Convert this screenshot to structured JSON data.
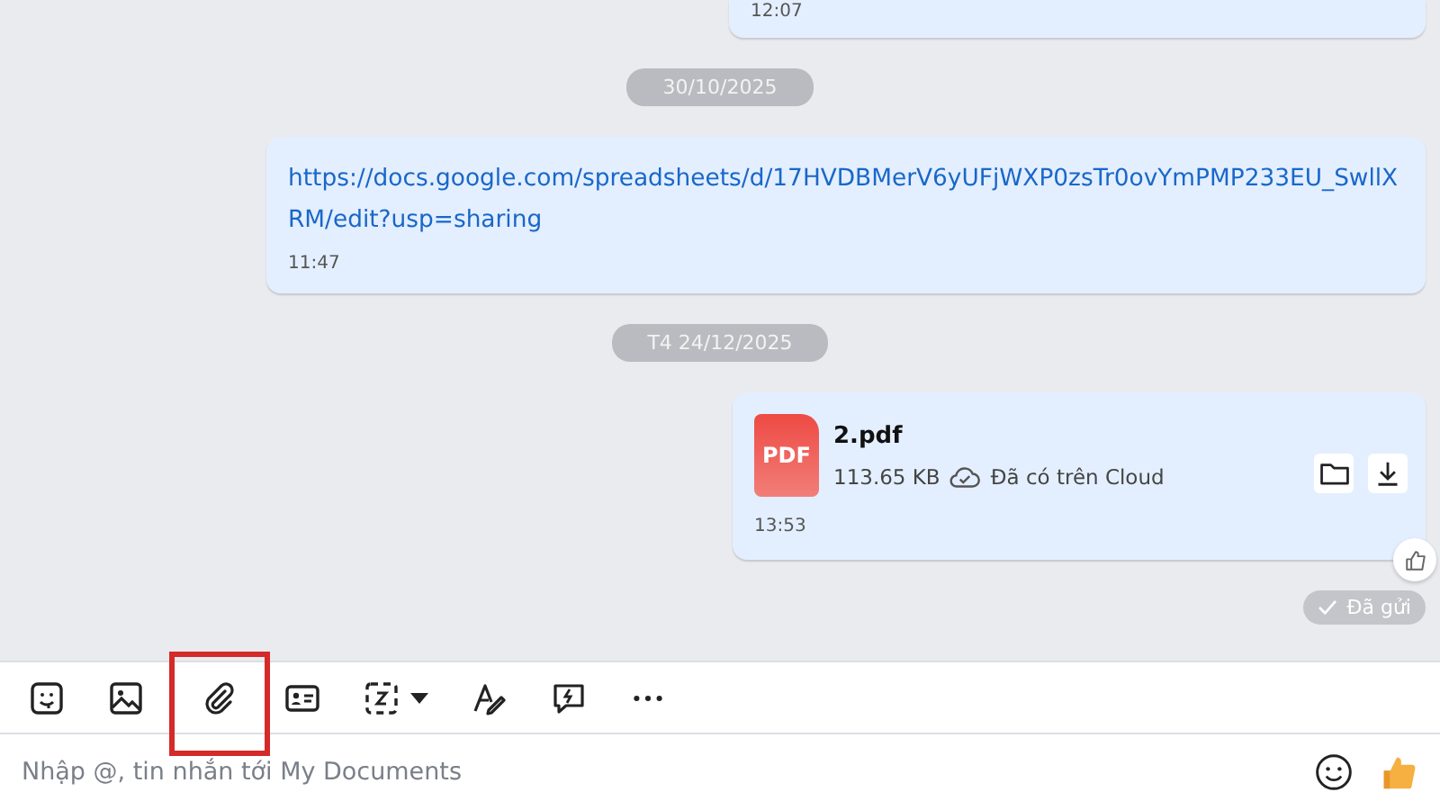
{
  "messages": [
    {
      "kind": "text",
      "time": "12:07"
    },
    {
      "kind": "date",
      "label": "30/10/2025"
    },
    {
      "kind": "link",
      "text": "https://docs.google.com/spreadsheets/d/17HVDBMerV6yUFjWXP0zsTr0ovYmPMP233EU_SwllXRM/edit?usp=sharing",
      "time": "11:47"
    },
    {
      "kind": "date",
      "label": "T4 24/12/2025"
    },
    {
      "kind": "file",
      "badge": "PDF",
      "name": "2.pdf",
      "size": "113.65 KB",
      "cloud": "Đã có trên Cloud",
      "time": "13:53"
    }
  ],
  "status": "Đã gửi",
  "toolbar": [
    {
      "kind": "sticker",
      "highlighted": false
    },
    {
      "kind": "image",
      "highlighted": false
    },
    {
      "kind": "attach",
      "highlighted": true
    },
    {
      "kind": "card",
      "highlighted": false
    },
    {
      "kind": "screenshot",
      "highlighted": false
    },
    {
      "kind": "format",
      "highlighted": false
    },
    {
      "kind": "quick",
      "highlighted": false
    },
    {
      "kind": "more",
      "highlighted": false
    }
  ],
  "composer": {
    "placeholder": "Nhập @, tin nhắn tới My Documents"
  }
}
